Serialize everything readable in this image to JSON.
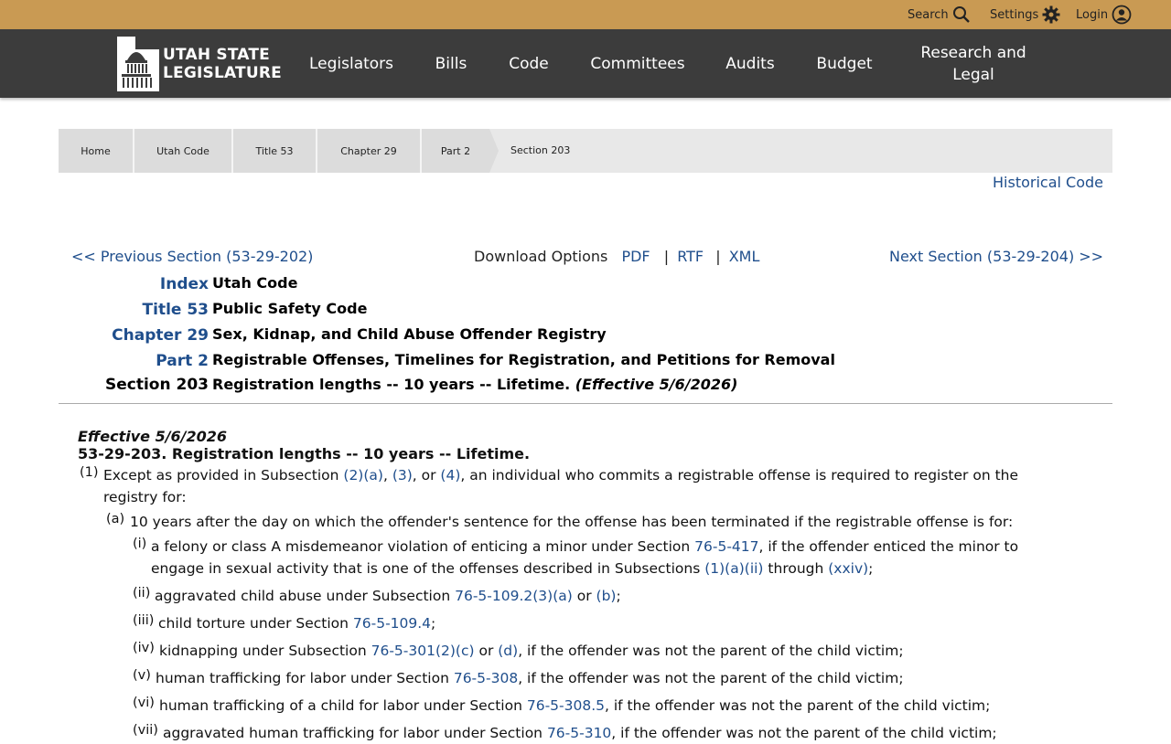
{
  "topbar": {
    "search_label": "Search",
    "settings_label": "Settings",
    "login_label": "Login",
    "color": "#c99a53"
  },
  "logo": {
    "line1": "UTAH STATE",
    "line2": "LEGISLATURE"
  },
  "nav": {
    "items": [
      "Legislators",
      "Bills",
      "Code",
      "Committees",
      "Audits",
      "Budget"
    ],
    "research_line1": "Research and",
    "research_line2": "Legal"
  },
  "breadcrumb": [
    "Home",
    "Utah Code",
    "Title 53",
    "Chapter 29",
    "Part 2",
    "Section 203"
  ],
  "historical_code": "Historical Code",
  "pager": {
    "prev": "<< Previous Section (53-29-202)",
    "next": "Next Section (53-29-204) >>",
    "download_label": "Download Options",
    "pdf": "PDF",
    "rtf": "RTF",
    "xml": "XML",
    "sep": "|"
  },
  "hierarchy": [
    {
      "label": "Index",
      "value": "Utah Code"
    },
    {
      "label": "Title 53",
      "value": "Public Safety Code"
    },
    {
      "label": "Chapter 29",
      "value": "Sex, Kidnap, and Child Abuse Offender Registry"
    },
    {
      "label": "Part 2",
      "value": "Registrable Offenses, Timelines for Registration, and Petitions for Removal"
    },
    {
      "label": "Section 203",
      "value": "Registration lengths -- 10 years -- Lifetime.",
      "effective": "(Effective 5/6/2026)"
    }
  ],
  "content": {
    "effective": "Effective 5/6/2026",
    "heading": "53-29-203.  Registration lengths -- 10 years -- Lifetime.",
    "s1_num": "(1)",
    "s1_a": "Except as provided in Subsection ",
    "s1_l1": "(2)(a)",
    "s1_b": ", ",
    "s1_l2": "(3)",
    "s1_c": ", or ",
    "s1_l3": "(4)",
    "s1_d": ", an individual who commits a registrable offense is required to register on the",
    "s1_line2": "registry for:",
    "a_num": "(a)",
    "a_text": "10 years after the day on which the offender's sentence for the offense has been terminated if the registrable offense is for:",
    "i_num": "(i)",
    "i_a": "a felony or class A misdemeanor violation of enticing a minor under Section ",
    "i_l1": "76-5-417",
    "i_b": ", if the offender enticed the minor to",
    "i_c": "engage in sexual activity that is one of the offenses described in Subsections ",
    "i_l2": "(1)(a)(ii)",
    "i_d": " through ",
    "i_l3": "(xxiv)",
    "i_e": ";",
    "ii_num": "(ii)",
    "ii_a": "aggravated child abuse under Subsection ",
    "ii_l1": "76-5-109.2(3)(a)",
    "ii_b": " or ",
    "ii_l2": "(b)",
    "ii_c": ";",
    "iii_num": "(iii)",
    "iii_a": "child torture under Section ",
    "iii_l1": "76-5-109.4",
    "iii_b": ";",
    "iv_num": "(iv)",
    "iv_a": "kidnapping under Subsection ",
    "iv_l1": "76-5-301(2)(c)",
    "iv_b": " or ",
    "iv_l2": "(d)",
    "iv_c": ", if the offender was not the parent of the child victim;",
    "v_num": "(v)",
    "v_a": "human trafficking for labor under Section ",
    "v_l1": "76-5-308",
    "v_b": ", if the offender was not the parent of the child victim;",
    "vi_num": "(vi)",
    "vi_a": "human trafficking of a child for labor under Section ",
    "vi_l1": "76-5-308.5",
    "vi_b": ", if the offender was not the parent of the child victim;",
    "vii_num": "(vii)",
    "vii_a": "aggravated human trafficking for labor under Section ",
    "vii_l1": "76-5-310",
    "vii_b": ", if the offender was not the parent of the child victim;"
  }
}
